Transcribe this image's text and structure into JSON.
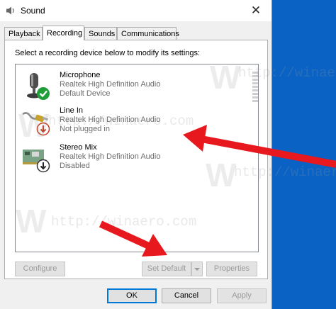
{
  "window": {
    "title": "Sound",
    "close_glyph": "✕"
  },
  "tabs": [
    {
      "label": "Playback",
      "active": false
    },
    {
      "label": "Recording",
      "active": true
    },
    {
      "label": "Sounds",
      "active": false
    },
    {
      "label": "Communications",
      "active": false
    }
  ],
  "recording": {
    "prompt": "Select a recording device below to modify its settings:",
    "devices": [
      {
        "name": "Microphone",
        "driver": "Realtek High Definition Audio",
        "status": "Default Device",
        "icon": "microphone-icon",
        "badge": "check-badge-icon"
      },
      {
        "name": "Line In",
        "driver": "Realtek High Definition Audio",
        "status": "Not plugged in",
        "icon": "line-in-jack-icon",
        "badge": "unplugged-badge-icon"
      },
      {
        "name": "Stereo Mix",
        "driver": "Realtek High Definition Audio",
        "status": "Disabled",
        "icon": "sound-card-icon",
        "badge": "disabled-badge-icon"
      }
    ],
    "buttons": {
      "configure": "Configure",
      "set_default": "Set Default",
      "properties": "Properties"
    }
  },
  "footer": {
    "ok": "OK",
    "cancel": "Cancel",
    "apply": "Apply"
  },
  "watermark": {
    "text": "http://winaero.com",
    "logo_letter": "W"
  },
  "colors": {
    "desktop": "#0a63c4",
    "accent": "#0078d7",
    "arrow": "#e8191e",
    "check_badge": "#1f9e3a",
    "unplugged_badge": "#c7361b"
  }
}
